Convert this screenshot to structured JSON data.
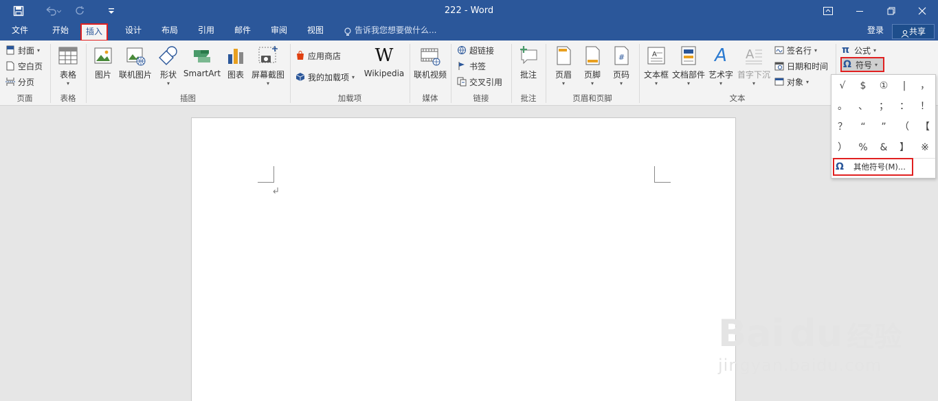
{
  "window": {
    "title": "222 - Word",
    "save_icon": "save-icon",
    "undo_icon": "undo-icon",
    "redo_icon": "redo-icon",
    "customize_icon": "customize-qat-icon"
  },
  "tabs": [
    "文件",
    "开始",
    "插入",
    "设计",
    "布局",
    "引用",
    "邮件",
    "审阅",
    "视图"
  ],
  "active_tab": "插入",
  "tell_me": "告诉我您想要做什么...",
  "account": {
    "login": "登录",
    "share": "共享"
  },
  "ribbon": {
    "page_group": {
      "label": "页面",
      "cover": "封面",
      "blank": "空白页",
      "break": "分页"
    },
    "table_group": {
      "label": "表格",
      "table": "表格"
    },
    "illus_group": {
      "label": "插图",
      "pictures": "图片",
      "online_pictures": "联机图片",
      "shapes": "形状",
      "smartart": "SmartArt",
      "chart": "图表",
      "screenshot": "屏幕截图"
    },
    "addins_group": {
      "label": "加载项",
      "store": "应用商店",
      "my_addins": "我的加载项",
      "wikipedia": "Wikipedia"
    },
    "media_group": {
      "label": "媒体",
      "online_video": "联机视频"
    },
    "links_group": {
      "label": "链接",
      "hyperlink": "超链接",
      "bookmark": "书签",
      "crossref": "交叉引用"
    },
    "comments_group": {
      "label": "批注",
      "comment": "批注"
    },
    "hf_group": {
      "label": "页眉和页脚",
      "header": "页眉",
      "footer": "页脚",
      "page_number": "页码"
    },
    "text_group": {
      "label": "文本",
      "textbox": "文本框",
      "quickparts": "文档部件",
      "wordart": "艺术字",
      "dropcap": "首字下沉",
      "signature": "签名行",
      "datetime": "日期和时间",
      "object": "对象"
    },
    "symbols_group": {
      "equation": "公式",
      "symbol": "符号"
    }
  },
  "symbol_dropdown": {
    "symbols": [
      "√",
      "$",
      "①",
      "|",
      "，",
      "。",
      "、",
      "；",
      "：",
      "！",
      "？",
      "“",
      "”",
      "（",
      "【",
      "）",
      "%",
      "&",
      "】",
      "※"
    ],
    "more": "其他符号(M)..."
  },
  "watermark": {
    "brand": "Bai",
    "brand2": "du",
    "brand_cn": "经验",
    "url": "jingyan.baidu.com"
  },
  "colors": {
    "accent": "#2b579a",
    "highlight": "#e02020"
  }
}
